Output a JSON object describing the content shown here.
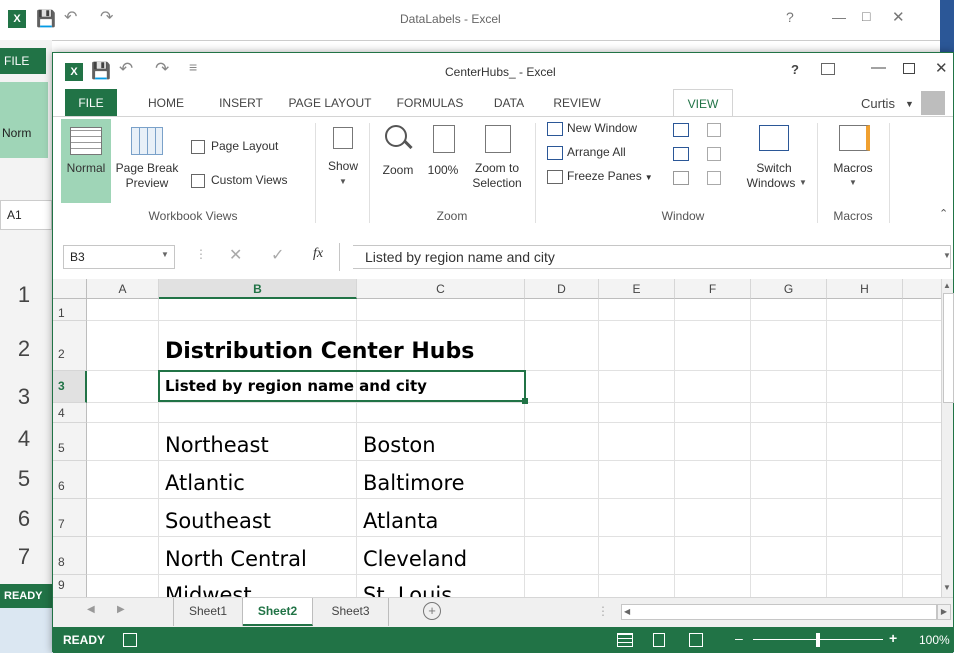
{
  "background_window": {
    "title": "DataLabels - Excel",
    "file_tab": "FILE",
    "normal_label": "Norm",
    "namebox": "A1",
    "row_numbers": [
      "1",
      "2",
      "3",
      "4",
      "5",
      "6",
      "7"
    ],
    "status": "READY"
  },
  "window": {
    "title": "CenterHubs_ - Excel",
    "help": "?",
    "user": "Curtis",
    "tabs": [
      "FILE",
      "HOME",
      "INSERT",
      "PAGE LAYOUT",
      "FORMULAS",
      "DATA",
      "REVIEW",
      "VIEW"
    ],
    "active_tab": "VIEW"
  },
  "ribbon": {
    "workbook_views": {
      "label": "Workbook Views",
      "normal": "Normal",
      "page_break_preview_1": "Page Break",
      "page_break_preview_2": "Preview",
      "page_layout": "Page Layout",
      "custom_views": "Custom Views"
    },
    "show": {
      "label": "Show"
    },
    "zoom": {
      "label": "Zoom",
      "zoom": "Zoom",
      "zoom_100": "100%",
      "zoom_to_selection_1": "Zoom to",
      "zoom_to_selection_2": "Selection"
    },
    "window": {
      "label": "Window",
      "new_window": "New Window",
      "arrange_all": "Arrange All",
      "freeze_panes": "Freeze Panes",
      "switch_windows_1": "Switch",
      "switch_windows_2": "Windows"
    },
    "macros": {
      "label": "Macros",
      "macros": "Macros"
    }
  },
  "formula_bar": {
    "namebox": "B3",
    "fx": "fx",
    "content": "Listed by region name and city"
  },
  "grid": {
    "columns": [
      "A",
      "B",
      "C",
      "D",
      "E",
      "F",
      "G",
      "H"
    ],
    "selected_column": "B",
    "rows": [
      "1",
      "2",
      "3",
      "4",
      "5",
      "6",
      "7",
      "8",
      "9"
    ],
    "selected_row": "3",
    "title": "Distribution Center Hubs",
    "subtitle": "Listed by region name and city",
    "data": [
      {
        "region": "Northeast",
        "city": "Boston"
      },
      {
        "region": "Atlantic",
        "city": "Baltimore"
      },
      {
        "region": "Southeast",
        "city": "Atlanta"
      },
      {
        "region": "North Central",
        "city": "Cleveland"
      },
      {
        "region": "Midwest",
        "city": "St. Louis"
      }
    ]
  },
  "sheets": [
    "Sheet1",
    "Sheet2",
    "Sheet3"
  ],
  "active_sheet": "Sheet2",
  "status": {
    "ready": "READY",
    "zoom": "100%"
  },
  "colors": {
    "accent": "#217346",
    "selected_header": "#e1e1e1"
  }
}
